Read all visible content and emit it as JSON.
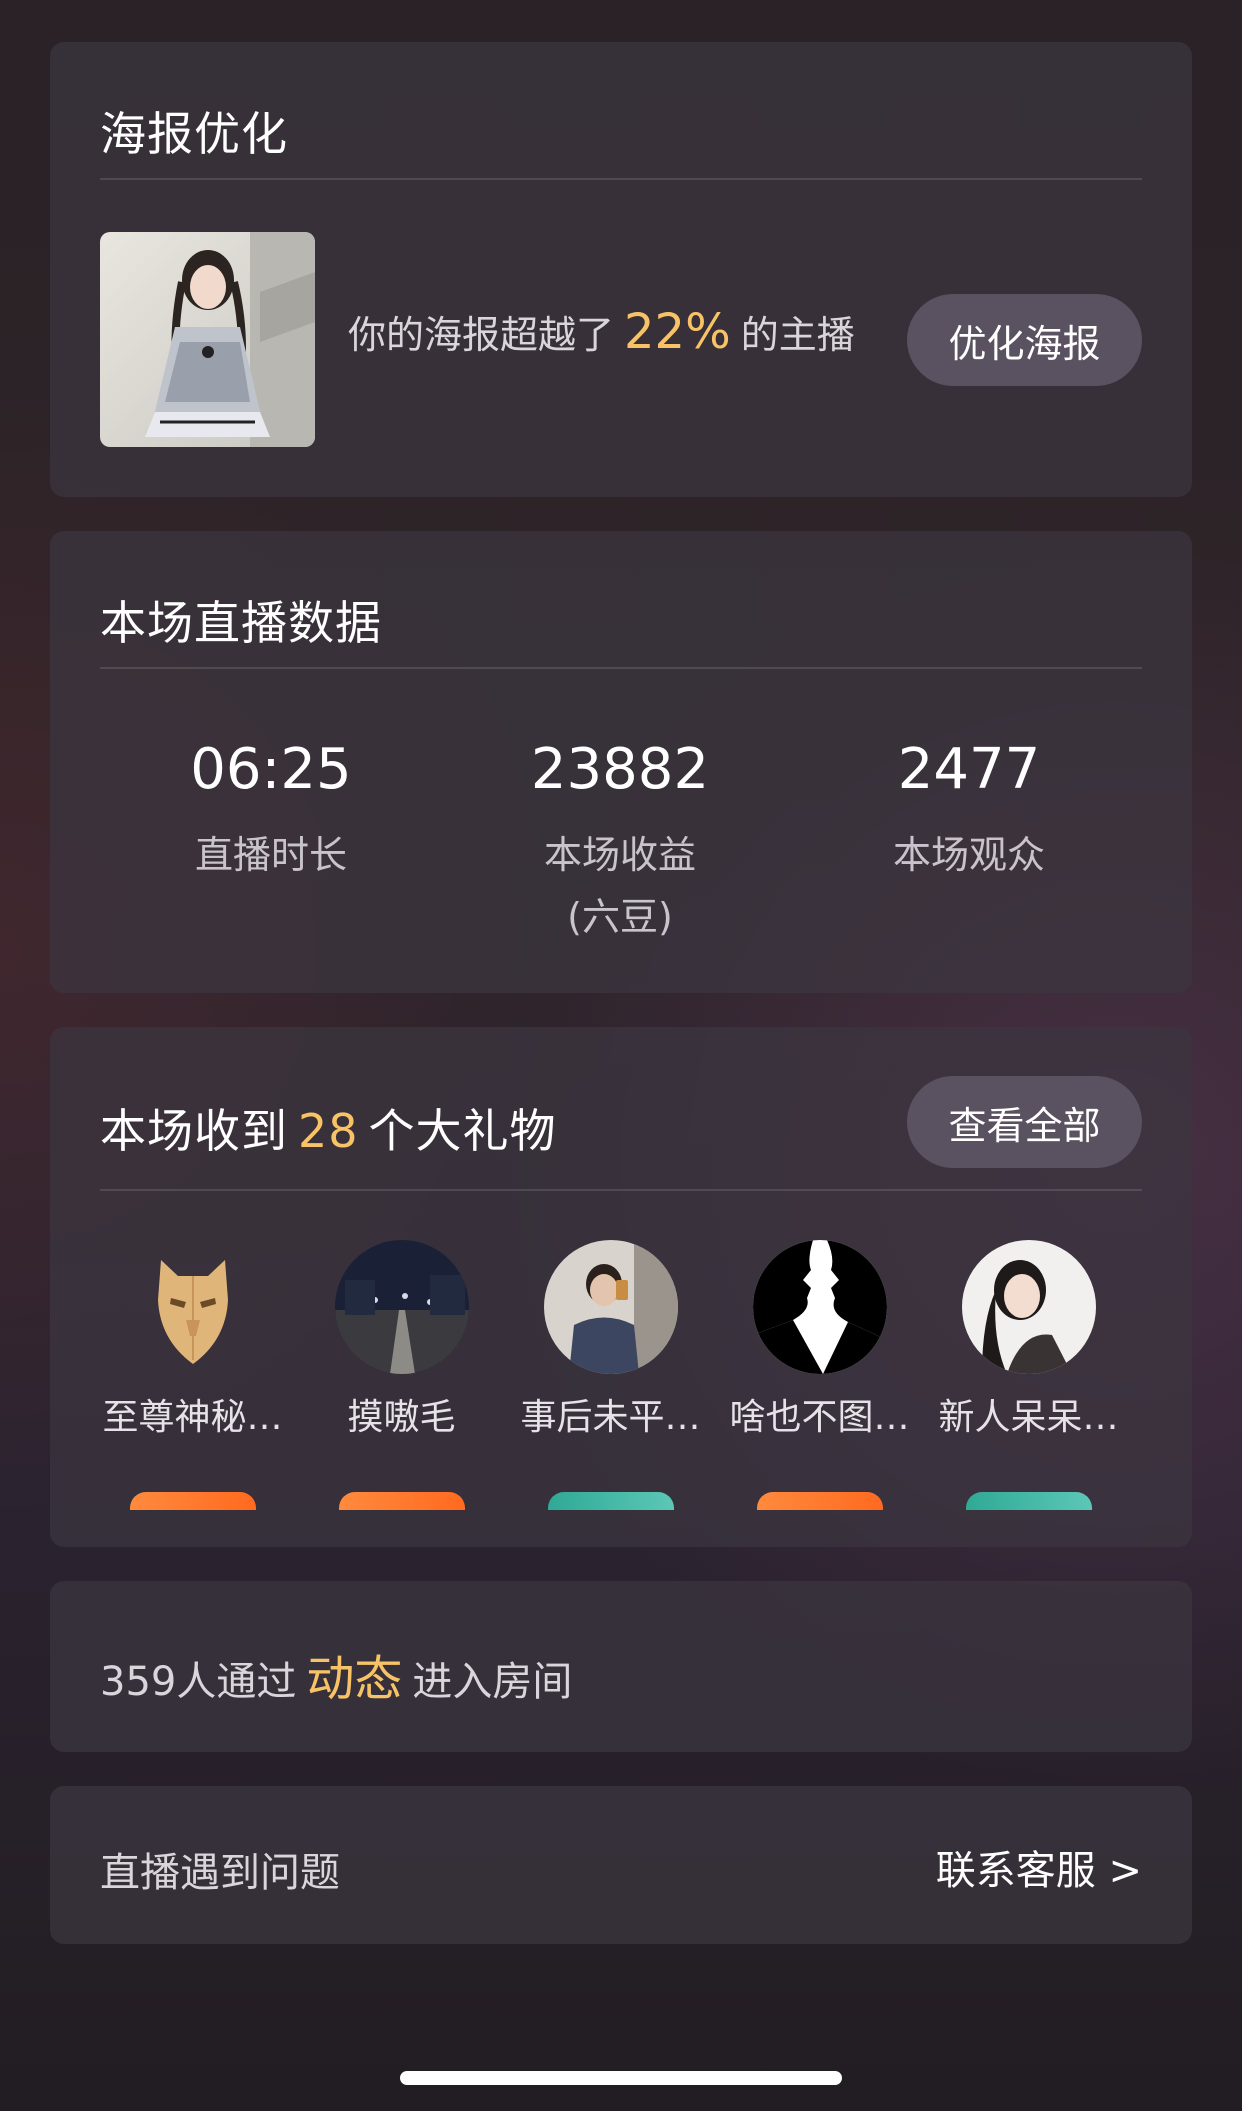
{
  "poster": {
    "title": "海报优化",
    "text_prefix": "你的海报超越了",
    "percent": "22%",
    "text_suffix": "的主播",
    "button": "优化海报"
  },
  "stats": {
    "title": "本场直播数据",
    "items": [
      {
        "value": "06:25",
        "label": "直播时长"
      },
      {
        "value": "23882",
        "label": "本场收益\n(六豆)"
      },
      {
        "value": "2477",
        "label": "本场观众"
      }
    ]
  },
  "gifts": {
    "title_prefix": "本场收到",
    "count": "28",
    "title_suffix": "个大礼物",
    "button": "查看全部",
    "gifters": [
      {
        "name": "至尊神秘…",
        "badge_color": "orange"
      },
      {
        "name": "摸嗷毛",
        "badge_color": "orange"
      },
      {
        "name": "事后未平…",
        "badge_color": "teal"
      },
      {
        "name": "啥也不图…",
        "badge_color": "orange"
      },
      {
        "name": "新人呆呆…",
        "badge_color": "teal"
      }
    ]
  },
  "dynamic": {
    "prefix": "359人通过",
    "highlight": "动态",
    "suffix": "进入房间"
  },
  "help": {
    "label": "直播遇到问题",
    "link": "联系客服 >"
  },
  "colors": {
    "accent": "#f7c366",
    "card_bg": "#3c3640",
    "pill_bg": "#5a5260"
  }
}
